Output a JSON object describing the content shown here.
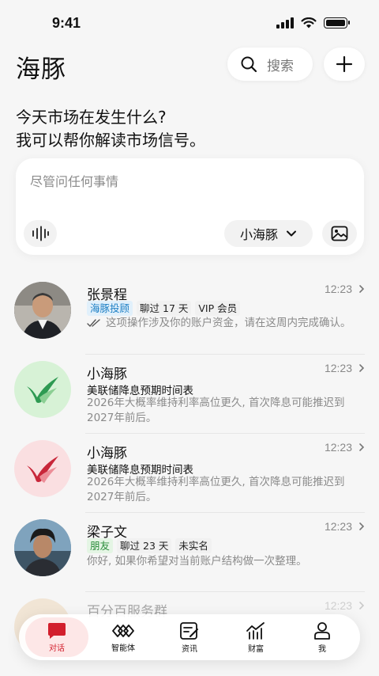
{
  "status_bar": {
    "time": "9:41"
  },
  "header": {
    "title": "海豚",
    "search_label": "搜索"
  },
  "intro": {
    "line1": "今天市场在发生什么?",
    "line2": "我可以帮你解读市场信号。"
  },
  "ask_card": {
    "placeholder": "尽管问任何事情",
    "model_label": "小海豚"
  },
  "conversations": [
    {
      "name": "张景程",
      "time": "12:23",
      "tags": [
        "海豚投顾",
        "聊过 17 天",
        "VIP 会员"
      ],
      "preview": "这项操作涉及你的账户资金，请在这周内完成确认。"
    },
    {
      "name": "小海豚",
      "time": "12:23",
      "subtitle": "美联储降息预期时间表",
      "preview": "2026年大概率维持利率高位更久, 首次降息可能推迟到2027年前后。"
    },
    {
      "name": "小海豚",
      "time": "12:23",
      "subtitle": "美联储降息预期时间表",
      "preview": "2026年大概率维持利率高位更久, 首次降息可能推迟到2027年前后。"
    },
    {
      "name": "梁子文",
      "time": "12:23",
      "tags": [
        "朋友",
        "聊过 23 天",
        "未实名"
      ],
      "preview": "你好, 如果你希望对当前账户结构做一次整理。"
    },
    {
      "name": "百分百服务群",
      "time": "12:23"
    }
  ],
  "tab_bar": {
    "tabs": [
      {
        "label": "对话",
        "icon": "chat-icon"
      },
      {
        "label": "智能体",
        "icon": "agent-icon"
      },
      {
        "label": "资讯",
        "icon": "news-icon"
      },
      {
        "label": "财富",
        "icon": "wealth-icon"
      },
      {
        "label": "我",
        "icon": "profile-icon"
      }
    ]
  },
  "colors": {
    "accent": "#d21f2d",
    "tag_blue": "#1d7fc4",
    "tag_green": "#2a8c3a",
    "dolphin_green": "#2e9a52",
    "dolphin_red": "#c8273a"
  }
}
